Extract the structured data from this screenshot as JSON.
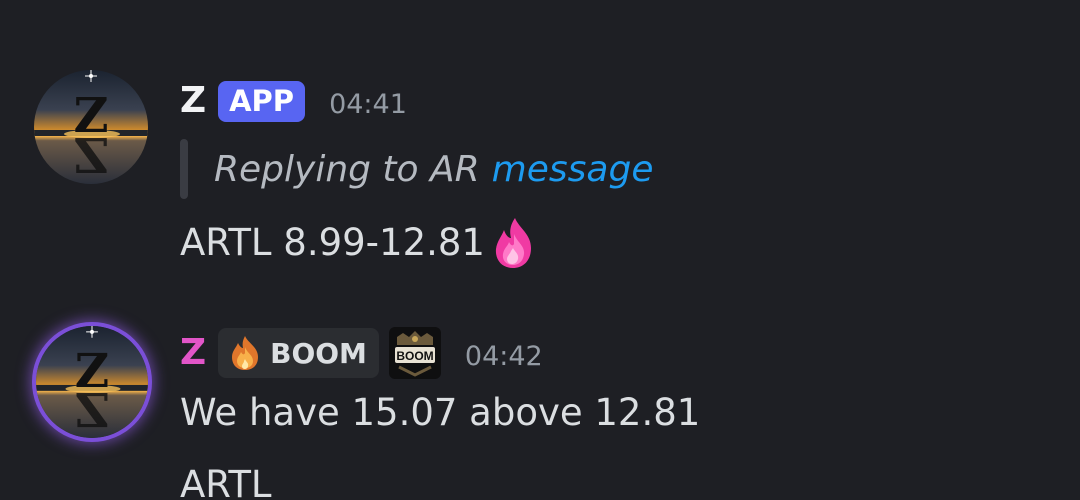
{
  "messages": [
    {
      "username": "Z",
      "username_color": "#f2f3f5",
      "badge": "APP",
      "badge_color": "#5865f2",
      "timestamp": "04:41",
      "reply": {
        "prefix": "Replying to AR",
        "link": "message",
        "link_color": "#1d9bf0"
      },
      "lines": [
        "ARTL 8.99-12.81"
      ],
      "trailing_emoji": "pink-fire-icon"
    },
    {
      "username": "Z",
      "username_color": "#e255c8",
      "tag": {
        "icon": "flame-icon",
        "label": "BOOM"
      },
      "server_logo_text": "BOOM",
      "timestamp": "04:42",
      "lines": [
        "We have 15.07 above 12.81",
        "ARTL"
      ]
    }
  ],
  "colors": {
    "background": "#1e1f24",
    "text": "#dbdee1",
    "muted": "#949ba4"
  }
}
